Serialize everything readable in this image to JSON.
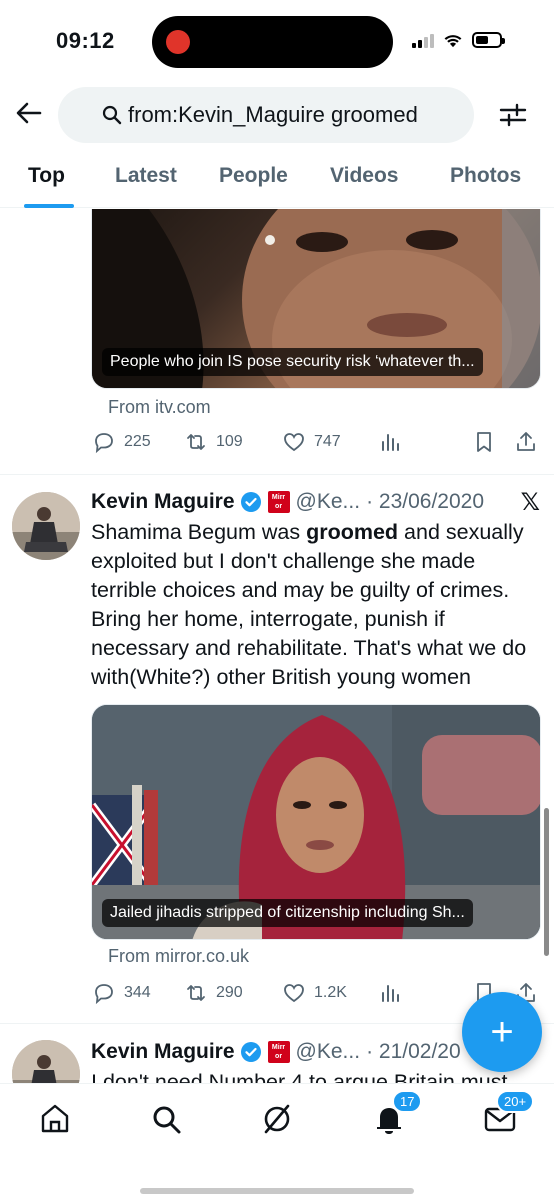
{
  "status_bar": {
    "time": "09:12"
  },
  "search": {
    "query": "from:Kevin_Maguire groomed"
  },
  "tabs": [
    {
      "label": "Top",
      "active": true
    },
    {
      "label": "Latest"
    },
    {
      "label": "People"
    },
    {
      "label": "Videos"
    },
    {
      "label": "Photos"
    }
  ],
  "tweets": [
    {
      "media_caption": "People who join IS pose security risk ‘whatever th...",
      "source": "From itv.com",
      "replies": "225",
      "reposts": "109",
      "likes": "747"
    },
    {
      "author": "Kevin Maguire",
      "handle": "@Ke...",
      "date": "· 23/06/2020",
      "text_before": "Shamima Begum was ",
      "text_bold": "groomed",
      "text_after": " and sexually exploited but I don't challenge she made terrible choices and may be guilty of crimes. Bring her home, interrogate, punish if necessary and rehabilitate. That's what we do with(White?) other British young women",
      "media_caption": "Jailed jihadis stripped of citizenship including Sh...",
      "source": "From mirror.co.uk",
      "replies": "344",
      "reposts": "290",
      "likes": "1.2K"
    },
    {
      "author": "Kevin Maguire",
      "handle": "@Ke...",
      "date": "· 21/02/20",
      "text": "I don't need Number 4 to argue Britain must"
    }
  ],
  "badge_logo_text": "Mirror",
  "bottom_nav": {
    "notifications_badge": "17",
    "messages_badge": "20+"
  },
  "colors": {
    "accent": "#1d9bf0",
    "muted": "#536471",
    "text": "#0f1419"
  }
}
